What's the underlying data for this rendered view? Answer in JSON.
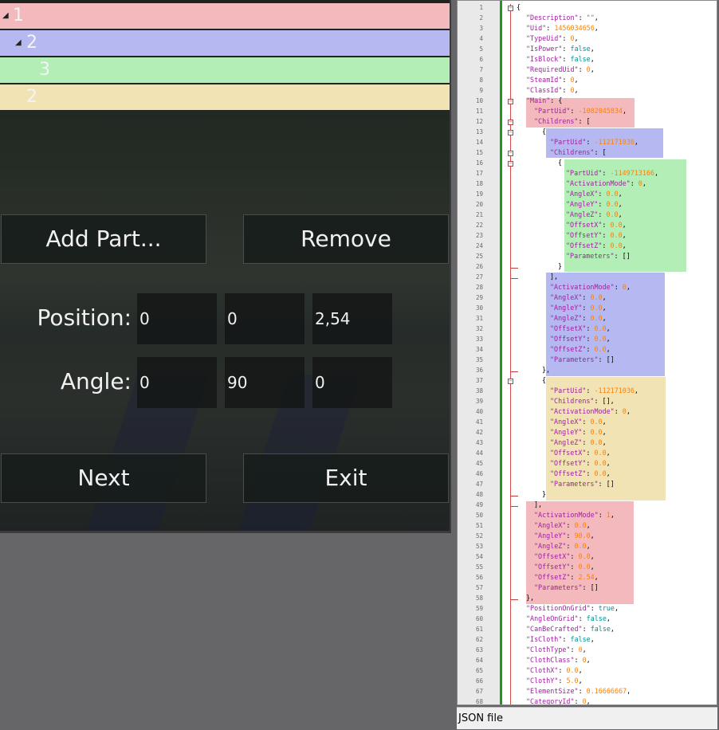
{
  "tree": [
    {
      "label": "1",
      "expanded": true,
      "color": "#f4b9bc"
    },
    {
      "label": "2",
      "expanded": true,
      "color": "#b6b9f1"
    },
    {
      "label": "3",
      "color": "#b3eeb7"
    },
    {
      "label": "2",
      "color": "#f1e3b3"
    }
  ],
  "buttons": {
    "add_part": "Add Part...",
    "remove": "Remove",
    "next": "Next",
    "exit": "Exit"
  },
  "position": {
    "label": "Position:",
    "x": "0",
    "y": "0",
    "z": "2,54"
  },
  "angle": {
    "label": "Angle:",
    "x": "0",
    "y": "90",
    "z": "0"
  },
  "status": "JSON file",
  "editor_lines": [
    [
      [
        "p",
        "{"
      ]
    ],
    [
      [
        "k",
        "\"Description\""
      ],
      [
        "p",
        ": "
      ],
      [
        "v-str",
        "\"\""
      ],
      [
        "p",
        ","
      ]
    ],
    [
      [
        "k",
        "\"Uid\""
      ],
      [
        "p",
        ": "
      ],
      [
        "v-num",
        "1456034656"
      ],
      [
        "p",
        ","
      ]
    ],
    [
      [
        "k",
        "\"TypeUid\""
      ],
      [
        "p",
        ": "
      ],
      [
        "v-num",
        "0"
      ],
      [
        "p",
        ","
      ]
    ],
    [
      [
        "k",
        "\"IsPower\""
      ],
      [
        "p",
        ": "
      ],
      [
        "v-kw",
        "false"
      ],
      [
        "p",
        ","
      ]
    ],
    [
      [
        "k",
        "\"IsBlock\""
      ],
      [
        "p",
        ": "
      ],
      [
        "v-kw",
        "false"
      ],
      [
        "p",
        ","
      ]
    ],
    [
      [
        "k",
        "\"RequiredUid\""
      ],
      [
        "p",
        ": "
      ],
      [
        "v-num",
        "0"
      ],
      [
        "p",
        ","
      ]
    ],
    [
      [
        "k",
        "\"SteamId\""
      ],
      [
        "p",
        ": "
      ],
      [
        "v-num",
        "0"
      ],
      [
        "p",
        ","
      ]
    ],
    [
      [
        "k",
        "\"ClassId\""
      ],
      [
        "p",
        ": "
      ],
      [
        "v-num",
        "0"
      ],
      [
        "p",
        ","
      ]
    ],
    [
      [
        "k",
        "\"Main\""
      ],
      [
        "p",
        ": {"
      ]
    ],
    [
      [
        "k",
        "\"PartUid\""
      ],
      [
        "p",
        ": "
      ],
      [
        "v-num",
        "-1082045834"
      ],
      [
        "p",
        ","
      ]
    ],
    [
      [
        "k",
        "\"Childrens\""
      ],
      [
        "p",
        ": ["
      ]
    ],
    [
      [
        "p",
        "{"
      ]
    ],
    [
      [
        "k",
        "\"PartUid\""
      ],
      [
        "p",
        ": "
      ],
      [
        "v-num",
        "-112171036"
      ],
      [
        "p",
        ","
      ]
    ],
    [
      [
        "k",
        "\"Childrens\""
      ],
      [
        "p",
        ": ["
      ]
    ],
    [
      [
        "p",
        "{"
      ]
    ],
    [
      [
        "k",
        "\"PartUid\""
      ],
      [
        "p",
        ": "
      ],
      [
        "v-num",
        "-1149713166"
      ],
      [
        "p",
        ","
      ]
    ],
    [
      [
        "k",
        "\"ActivationMode\""
      ],
      [
        "p",
        ": "
      ],
      [
        "v-num",
        "0"
      ],
      [
        "p",
        ","
      ]
    ],
    [
      [
        "k",
        "\"AngleX\""
      ],
      [
        "p",
        ": "
      ],
      [
        "v-num",
        "0.0"
      ],
      [
        "p",
        ","
      ]
    ],
    [
      [
        "k",
        "\"AngleY\""
      ],
      [
        "p",
        ": "
      ],
      [
        "v-num",
        "0.0"
      ],
      [
        "p",
        ","
      ]
    ],
    [
      [
        "k",
        "\"AngleZ\""
      ],
      [
        "p",
        ": "
      ],
      [
        "v-num",
        "0.0"
      ],
      [
        "p",
        ","
      ]
    ],
    [
      [
        "k",
        "\"OffsetX\""
      ],
      [
        "p",
        ": "
      ],
      [
        "v-num",
        "0.0"
      ],
      [
        "p",
        ","
      ]
    ],
    [
      [
        "k",
        "\"OffsetY\""
      ],
      [
        "p",
        ": "
      ],
      [
        "v-num",
        "0.0"
      ],
      [
        "p",
        ","
      ]
    ],
    [
      [
        "k",
        "\"OffsetZ\""
      ],
      [
        "p",
        ": "
      ],
      [
        "v-num",
        "0.0"
      ],
      [
        "p",
        ","
      ]
    ],
    [
      [
        "k",
        "\"Parameters\""
      ],
      [
        "p",
        ": []"
      ]
    ],
    [
      [
        "p",
        "}"
      ]
    ],
    [
      [
        "p",
        "],"
      ]
    ],
    [
      [
        "k",
        "\"ActivationMode\""
      ],
      [
        "p",
        ": "
      ],
      [
        "v-num",
        "0"
      ],
      [
        "p",
        ","
      ]
    ],
    [
      [
        "k",
        "\"AngleX\""
      ],
      [
        "p",
        ": "
      ],
      [
        "v-num",
        "0.0"
      ],
      [
        "p",
        ","
      ]
    ],
    [
      [
        "k",
        "\"AngleY\""
      ],
      [
        "p",
        ": "
      ],
      [
        "v-num",
        "0.0"
      ],
      [
        "p",
        ","
      ]
    ],
    [
      [
        "k",
        "\"AngleZ\""
      ],
      [
        "p",
        ": "
      ],
      [
        "v-num",
        "0.0"
      ],
      [
        "p",
        ","
      ]
    ],
    [
      [
        "k",
        "\"OffsetX\""
      ],
      [
        "p",
        ": "
      ],
      [
        "v-num",
        "0.0"
      ],
      [
        "p",
        ","
      ]
    ],
    [
      [
        "k",
        "\"OffsetY\""
      ],
      [
        "p",
        ": "
      ],
      [
        "v-num",
        "0.0"
      ],
      [
        "p",
        ","
      ]
    ],
    [
      [
        "k",
        "\"OffsetZ\""
      ],
      [
        "p",
        ": "
      ],
      [
        "v-num",
        "0.0"
      ],
      [
        "p",
        ","
      ]
    ],
    [
      [
        "k",
        "\"Parameters\""
      ],
      [
        "p",
        ": []"
      ]
    ],
    [
      [
        "p",
        "},"
      ]
    ],
    [
      [
        "p",
        "{"
      ]
    ],
    [
      [
        "k",
        "\"PartUid\""
      ],
      [
        "p",
        ": "
      ],
      [
        "v-num",
        "-112171036"
      ],
      [
        "p",
        ","
      ]
    ],
    [
      [
        "k",
        "\"Childrens\""
      ],
      [
        "p",
        ": [],"
      ]
    ],
    [
      [
        "k",
        "\"ActivationMode\""
      ],
      [
        "p",
        ": "
      ],
      [
        "v-num",
        "0"
      ],
      [
        "p",
        ","
      ]
    ],
    [
      [
        "k",
        "\"AngleX\""
      ],
      [
        "p",
        ": "
      ],
      [
        "v-num",
        "0.0"
      ],
      [
        "p",
        ","
      ]
    ],
    [
      [
        "k",
        "\"AngleY\""
      ],
      [
        "p",
        ": "
      ],
      [
        "v-num",
        "0.0"
      ],
      [
        "p",
        ","
      ]
    ],
    [
      [
        "k",
        "\"AngleZ\""
      ],
      [
        "p",
        ": "
      ],
      [
        "v-num",
        "0.0"
      ],
      [
        "p",
        ","
      ]
    ],
    [
      [
        "k",
        "\"OffsetX\""
      ],
      [
        "p",
        ": "
      ],
      [
        "v-num",
        "0.0"
      ],
      [
        "p",
        ","
      ]
    ],
    [
      [
        "k",
        "\"OffsetY\""
      ],
      [
        "p",
        ": "
      ],
      [
        "v-num",
        "0.0"
      ],
      [
        "p",
        ","
      ]
    ],
    [
      [
        "k",
        "\"OffsetZ\""
      ],
      [
        "p",
        ": "
      ],
      [
        "v-num",
        "0.0"
      ],
      [
        "p",
        ","
      ]
    ],
    [
      [
        "k",
        "\"Parameters\""
      ],
      [
        "p",
        ": []"
      ]
    ],
    [
      [
        "p",
        "}"
      ]
    ],
    [
      [
        "p",
        "],"
      ]
    ],
    [
      [
        "k",
        "\"ActivationMode\""
      ],
      [
        "p",
        ": "
      ],
      [
        "v-num",
        "1"
      ],
      [
        "p",
        ","
      ]
    ],
    [
      [
        "k",
        "\"AngleX\""
      ],
      [
        "p",
        ": "
      ],
      [
        "v-num",
        "0.0"
      ],
      [
        "p",
        ","
      ]
    ],
    [
      [
        "k",
        "\"AngleY\""
      ],
      [
        "p",
        ": "
      ],
      [
        "v-num",
        "90.0"
      ],
      [
        "p",
        ","
      ]
    ],
    [
      [
        "k",
        "\"AngleZ\""
      ],
      [
        "p",
        ": "
      ],
      [
        "v-num",
        "0.0"
      ],
      [
        "p",
        ","
      ]
    ],
    [
      [
        "k",
        "\"OffsetX\""
      ],
      [
        "p",
        ": "
      ],
      [
        "v-num",
        "0.0"
      ],
      [
        "p",
        ","
      ]
    ],
    [
      [
        "k",
        "\"OffsetY\""
      ],
      [
        "p",
        ": "
      ],
      [
        "v-num",
        "0.0"
      ],
      [
        "p",
        ","
      ]
    ],
    [
      [
        "k",
        "\"OffsetZ\""
      ],
      [
        "p",
        ": "
      ],
      [
        "v-num",
        "2.54"
      ],
      [
        "p",
        ","
      ]
    ],
    [
      [
        "k",
        "\"Parameters\""
      ],
      [
        "p",
        ": []"
      ]
    ],
    [
      [
        "p",
        "},"
      ]
    ],
    [
      [
        "k",
        "\"PositionOnGrid\""
      ],
      [
        "p",
        ": "
      ],
      [
        "v-kw",
        "true"
      ],
      [
        "p",
        ","
      ]
    ],
    [
      [
        "k",
        "\"AngleOnGrid\""
      ],
      [
        "p",
        ": "
      ],
      [
        "v-kw",
        "false"
      ],
      [
        "p",
        ","
      ]
    ],
    [
      [
        "k",
        "\"CanBeCrafted\""
      ],
      [
        "p",
        ": "
      ],
      [
        "v-kw",
        "false"
      ],
      [
        "p",
        ","
      ]
    ],
    [
      [
        "k",
        "\"IsCloth\""
      ],
      [
        "p",
        ": "
      ],
      [
        "v-kw",
        "false"
      ],
      [
        "p",
        ","
      ]
    ],
    [
      [
        "k",
        "\"ClothType\""
      ],
      [
        "p",
        ": "
      ],
      [
        "v-num",
        "0"
      ],
      [
        "p",
        ","
      ]
    ],
    [
      [
        "k",
        "\"ClothClass\""
      ],
      [
        "p",
        ": "
      ],
      [
        "v-num",
        "0"
      ],
      [
        "p",
        ","
      ]
    ],
    [
      [
        "k",
        "\"ClothX\""
      ],
      [
        "p",
        ": "
      ],
      [
        "v-num",
        "0.0"
      ],
      [
        "p",
        ","
      ]
    ],
    [
      [
        "k",
        "\"ClothY\""
      ],
      [
        "p",
        ": "
      ],
      [
        "v-num",
        "5.0"
      ],
      [
        "p",
        ","
      ]
    ],
    [
      [
        "k",
        "\"ElementSize\""
      ],
      [
        "p",
        ": "
      ],
      [
        "v-num",
        "0.16666667"
      ],
      [
        "p",
        ","
      ]
    ],
    [
      [
        "k",
        "\"CategoryId\""
      ],
      [
        "p",
        ": "
      ],
      [
        "v-num",
        "0"
      ],
      [
        "p",
        ","
      ]
    ]
  ]
}
